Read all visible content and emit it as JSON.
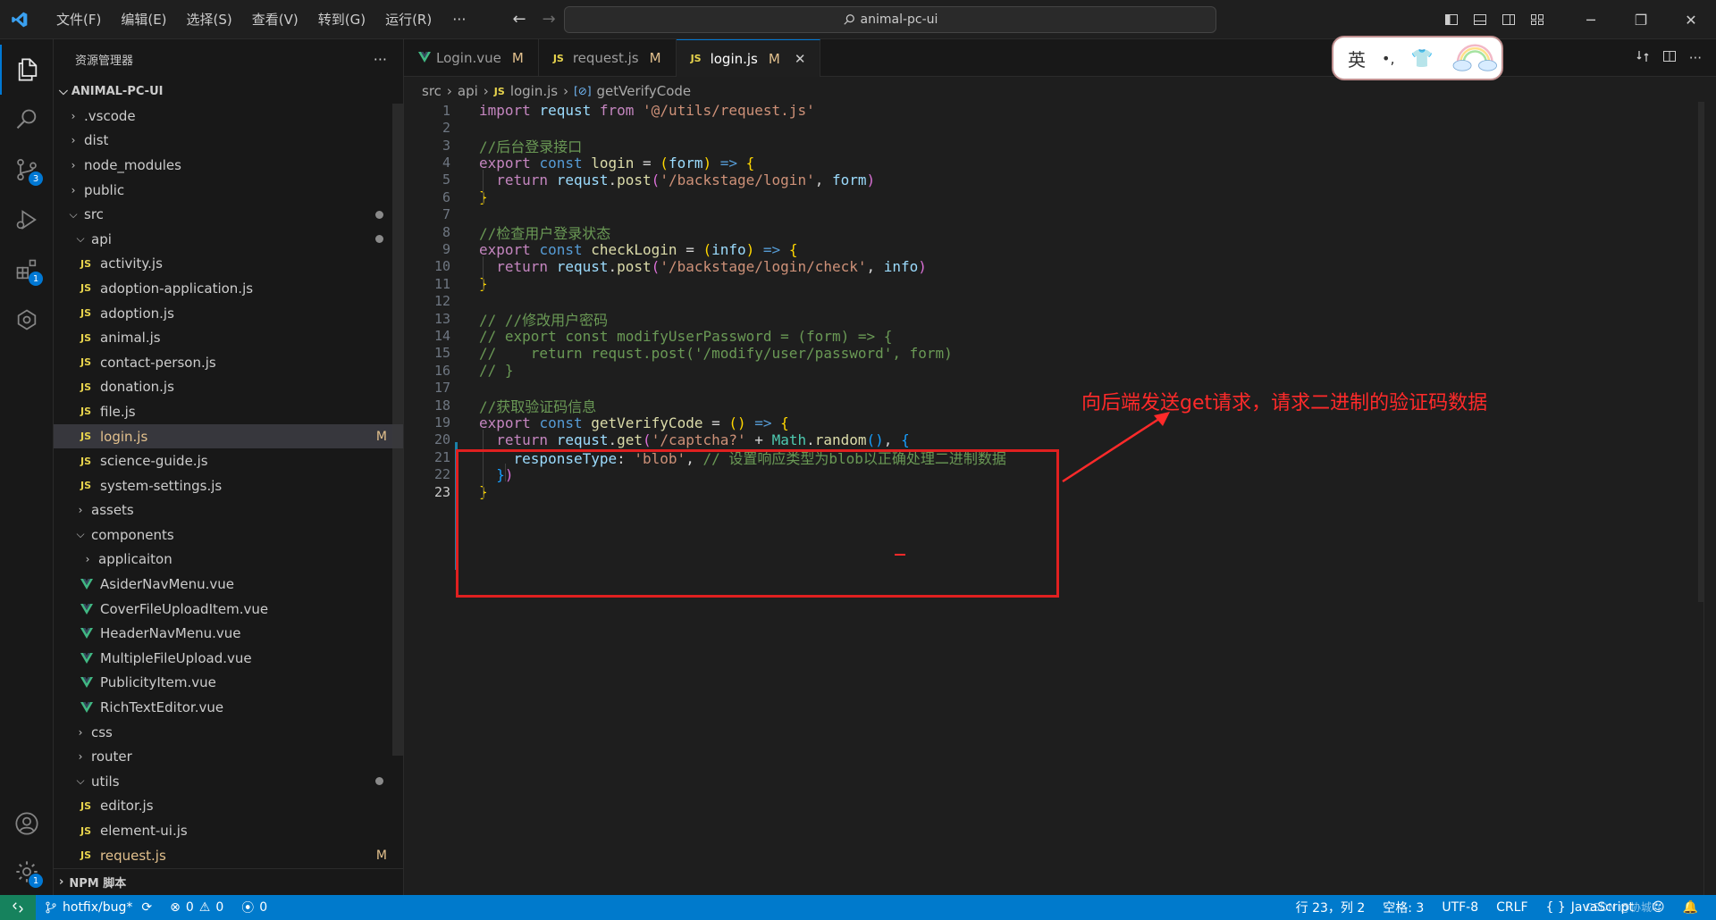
{
  "titlebar": {
    "menu": [
      "文件(F)",
      "编辑(E)",
      "选择(S)",
      "查看(V)",
      "转到(G)",
      "运行(R)"
    ],
    "more": "···",
    "search": "animal-pc-ui"
  },
  "activitybar": {
    "badges": {
      "scm": "3",
      "extensions": "1",
      "settings": "1"
    }
  },
  "explorer": {
    "header": "资源管理器",
    "more": "···",
    "root": "ANIMAL-PC-UI",
    "npm": "NPM 脚本",
    "items": [
      {
        "label": ".vscode",
        "type": "folder",
        "depth": 0,
        "open": false
      },
      {
        "label": "dist",
        "type": "folder",
        "depth": 0,
        "open": false
      },
      {
        "label": "node_modules",
        "type": "folder",
        "depth": 0,
        "open": false
      },
      {
        "label": "public",
        "type": "folder",
        "depth": 0,
        "open": false
      },
      {
        "label": "src",
        "type": "folder",
        "depth": 0,
        "open": true,
        "dot": true
      },
      {
        "label": "api",
        "type": "folder",
        "depth": 1,
        "open": true,
        "dot": true
      },
      {
        "label": "activity.js",
        "type": "js",
        "depth": 2
      },
      {
        "label": "adoption-application.js",
        "type": "js",
        "depth": 2
      },
      {
        "label": "adoption.js",
        "type": "js",
        "depth": 2
      },
      {
        "label": "animal.js",
        "type": "js",
        "depth": 2
      },
      {
        "label": "contact-person.js",
        "type": "js",
        "depth": 2
      },
      {
        "label": "donation.js",
        "type": "js",
        "depth": 2
      },
      {
        "label": "file.js",
        "type": "js",
        "depth": 2
      },
      {
        "label": "login.js",
        "type": "js",
        "depth": 2,
        "selected": true,
        "status": "M"
      },
      {
        "label": "science-guide.js",
        "type": "js",
        "depth": 2
      },
      {
        "label": "system-settings.js",
        "type": "js",
        "depth": 2
      },
      {
        "label": "assets",
        "type": "folder",
        "depth": 1,
        "open": false
      },
      {
        "label": "components",
        "type": "folder",
        "depth": 1,
        "open": true
      },
      {
        "label": "applicaiton",
        "type": "folder",
        "depth": 2,
        "open": false
      },
      {
        "label": "AsiderNavMenu.vue",
        "type": "vue",
        "depth": 2
      },
      {
        "label": "CoverFileUploadItem.vue",
        "type": "vue",
        "depth": 2
      },
      {
        "label": "HeaderNavMenu.vue",
        "type": "vue",
        "depth": 2
      },
      {
        "label": "MultipleFileUpload.vue",
        "type": "vue",
        "depth": 2
      },
      {
        "label": "PublicityItem.vue",
        "type": "vue",
        "depth": 2
      },
      {
        "label": "RichTextEditor.vue",
        "type": "vue",
        "depth": 2
      },
      {
        "label": "css",
        "type": "folder",
        "depth": 1,
        "open": false
      },
      {
        "label": "router",
        "type": "folder",
        "depth": 1,
        "open": false
      },
      {
        "label": "utils",
        "type": "folder",
        "depth": 1,
        "open": true,
        "dot": true
      },
      {
        "label": "editor.js",
        "type": "js",
        "depth": 2
      },
      {
        "label": "element-ui.js",
        "type": "js",
        "depth": 2
      },
      {
        "label": "request.js",
        "type": "js",
        "depth": 2,
        "status": "M"
      }
    ]
  },
  "tabs": [
    {
      "label": "Login.vue",
      "icon": "vue",
      "status": "M",
      "active": false
    },
    {
      "label": "request.js",
      "icon": "js",
      "status": "M",
      "active": false
    },
    {
      "label": "login.js",
      "icon": "js",
      "status": "M",
      "active": true
    }
  ],
  "breadcrumb": {
    "p1": "src",
    "p2": "api",
    "p3": "login.js",
    "p4": "getVerifyCode",
    "js": "JS"
  },
  "code": [
    [
      [
        "kw2",
        "import "
      ],
      [
        "id",
        "requst "
      ],
      [
        "kw2",
        "from "
      ],
      [
        "str",
        "'@/utils/request.js'"
      ]
    ],
    [],
    [
      [
        "cm",
        "//后台登录接口"
      ]
    ],
    [
      [
        "kw2",
        "export "
      ],
      [
        "kw",
        "const "
      ],
      [
        "fn",
        "login "
      ],
      [
        "pn",
        "= "
      ],
      [
        "br1",
        "("
      ],
      [
        "id",
        "form"
      ],
      [
        "br1",
        ")"
      ],
      [
        "pn",
        " "
      ],
      [
        "kw",
        "=>"
      ],
      [
        "pn",
        " "
      ],
      [
        "br1",
        "{"
      ]
    ],
    [
      [
        "pn",
        "  "
      ],
      [
        "kw2",
        "return "
      ],
      [
        "id",
        "requst"
      ],
      [
        "pn",
        "."
      ],
      [
        "fn",
        "post"
      ],
      [
        "br2",
        "("
      ],
      [
        "str",
        "'/backstage/login'"
      ],
      [
        "pn",
        ", "
      ],
      [
        "id",
        "form"
      ],
      [
        "br2",
        ")"
      ]
    ],
    [
      [
        "br1",
        "}"
      ]
    ],
    [],
    [
      [
        "cm",
        "//检查用户登录状态"
      ]
    ],
    [
      [
        "kw2",
        "export "
      ],
      [
        "kw",
        "const "
      ],
      [
        "fn",
        "checkLogin "
      ],
      [
        "pn",
        "= "
      ],
      [
        "br1",
        "("
      ],
      [
        "id",
        "info"
      ],
      [
        "br1",
        ")"
      ],
      [
        "pn",
        " "
      ],
      [
        "kw",
        "=>"
      ],
      [
        "pn",
        " "
      ],
      [
        "br1",
        "{"
      ]
    ],
    [
      [
        "pn",
        "  "
      ],
      [
        "kw2",
        "return "
      ],
      [
        "id",
        "requst"
      ],
      [
        "pn",
        "."
      ],
      [
        "fn",
        "post"
      ],
      [
        "br2",
        "("
      ],
      [
        "str",
        "'/backstage/login/check'"
      ],
      [
        "pn",
        ", "
      ],
      [
        "id",
        "info"
      ],
      [
        "br2",
        ")"
      ]
    ],
    [
      [
        "br1",
        "}"
      ]
    ],
    [],
    [
      [
        "cm",
        "// //修改用户密码"
      ]
    ],
    [
      [
        "cm",
        "// export const modifyUserPassword = (form) => {"
      ]
    ],
    [
      [
        "cm",
        "//    return requst.post('/modify/user/password', form)"
      ]
    ],
    [
      [
        "cm",
        "// }"
      ]
    ],
    [],
    [
      [
        "cm",
        "//获取验证码信息"
      ]
    ],
    [
      [
        "kw2",
        "export "
      ],
      [
        "kw",
        "const "
      ],
      [
        "fn",
        "getVerifyCode "
      ],
      [
        "pn",
        "= "
      ],
      [
        "br1",
        "()"
      ],
      [
        "pn",
        " "
      ],
      [
        "kw",
        "=>"
      ],
      [
        "pn",
        " "
      ],
      [
        "br1",
        "{"
      ]
    ],
    [
      [
        "pn",
        "  "
      ],
      [
        "kw2",
        "return "
      ],
      [
        "id",
        "requst"
      ],
      [
        "pn",
        "."
      ],
      [
        "fn",
        "get"
      ],
      [
        "br2",
        "("
      ],
      [
        "str",
        "'/captcha?'"
      ],
      [
        "pn",
        " + "
      ],
      [
        "cls",
        "Math"
      ],
      [
        "pn",
        "."
      ],
      [
        "fn",
        "random"
      ],
      [
        "br3",
        "()"
      ],
      [
        "pn",
        ", "
      ],
      [
        "br3",
        "{"
      ]
    ],
    [
      [
        "pn",
        "    "
      ],
      [
        "id",
        "responseType"
      ],
      [
        "pn",
        ": "
      ],
      [
        "str",
        "'blob'"
      ],
      [
        "pn",
        ", "
      ],
      [
        "cm",
        "// 设置响应类型为blob以正确处理二进制数据"
      ]
    ],
    [
      [
        "pn",
        "  "
      ],
      [
        "br3",
        "}"
      ],
      [
        "br2",
        ")"
      ]
    ],
    [
      [
        "br1",
        "}"
      ]
    ]
  ],
  "annotation": "向后端发送get请求，请求二进制的验证码数据",
  "ime": {
    "lang": "英",
    "punct": "•,"
  },
  "status": {
    "branch": "hotfix/bug*",
    "errors": "0",
    "warnings": "0",
    "ports": "0",
    "position": "行 23，列 2",
    "spaces": "空格: 3",
    "encoding": "UTF-8",
    "eol": "CRLF",
    "language": "JavaScript",
    "watermark": "CSDN @协城吖"
  }
}
